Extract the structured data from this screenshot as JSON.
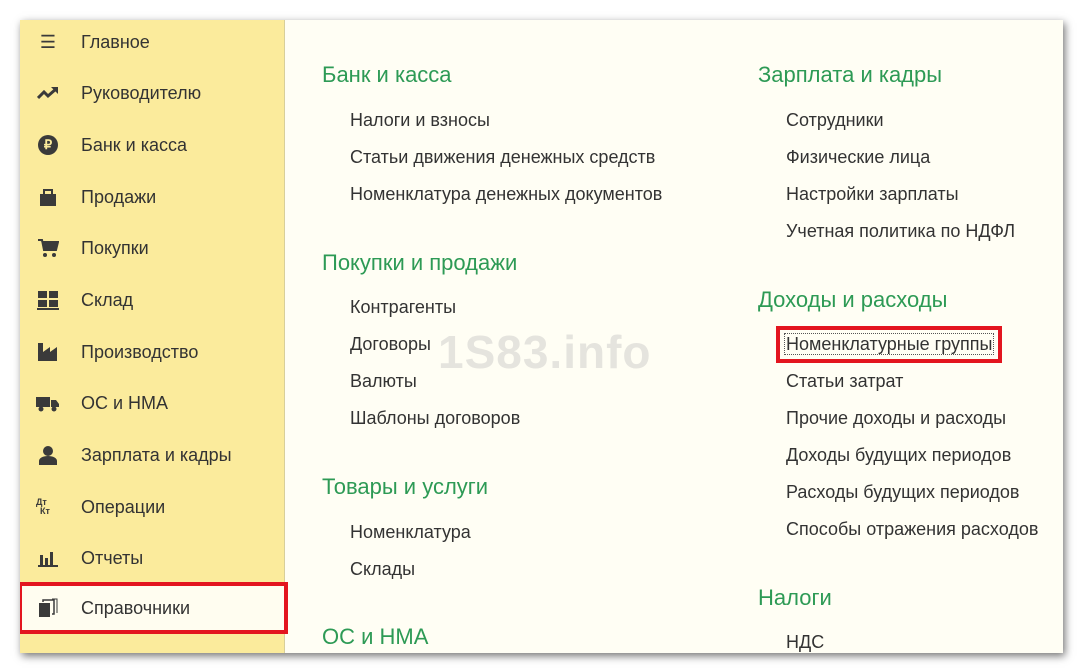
{
  "sidebar": {
    "items": [
      {
        "label": "Главное",
        "icon": "menu-icon"
      },
      {
        "label": "Руководителю",
        "icon": "trend-icon"
      },
      {
        "label": "Банк и касса",
        "icon": "ruble-icon"
      },
      {
        "label": "Продажи",
        "icon": "bag-icon"
      },
      {
        "label": "Покупки",
        "icon": "cart-icon"
      },
      {
        "label": "Склад",
        "icon": "warehouse-icon"
      },
      {
        "label": "Производство",
        "icon": "factory-icon"
      },
      {
        "label": "ОС и НМА",
        "icon": "truck-icon"
      },
      {
        "label": "Зарплата и кадры",
        "icon": "person-icon"
      },
      {
        "label": "Операции",
        "icon": "dt-kt-icon"
      },
      {
        "label": "Отчеты",
        "icon": "bar-chart-icon"
      },
      {
        "label": "Справочники",
        "icon": "documents-icon",
        "active": true
      }
    ]
  },
  "sections": {
    "bank": {
      "title": "Банк и касса",
      "items": [
        "Налоги и взносы",
        "Статьи движения денежных средств",
        "Номенклатура денежных документов"
      ]
    },
    "trade": {
      "title": "Покупки и продажи",
      "items": [
        "Контрагенты",
        "Договоры",
        "Валюты",
        "Шаблоны договоров"
      ]
    },
    "goods": {
      "title": "Товары и услуги",
      "items": [
        "Номенклатура",
        "Склады"
      ]
    },
    "os": {
      "title": "ОС и НМА"
    },
    "salary": {
      "title": "Зарплата и кадры",
      "items": [
        "Сотрудники",
        "Физические лица",
        "Настройки зарплаты",
        "Учетная политика по НДФЛ"
      ]
    },
    "income": {
      "title": "Доходы и расходы",
      "items": [
        "Номенклатурные группы",
        "Статьи затрат",
        "Прочие доходы и расходы",
        "Доходы будущих периодов",
        "Расходы будущих периодов",
        "Способы отражения расходов"
      ]
    },
    "taxes": {
      "title": "Налоги",
      "items": [
        "НДС"
      ]
    }
  },
  "watermark": "1S83.info",
  "colors": {
    "sidebar": "#fbeb9c",
    "heading": "#2d9a55",
    "highlight": "#e3151f"
  }
}
